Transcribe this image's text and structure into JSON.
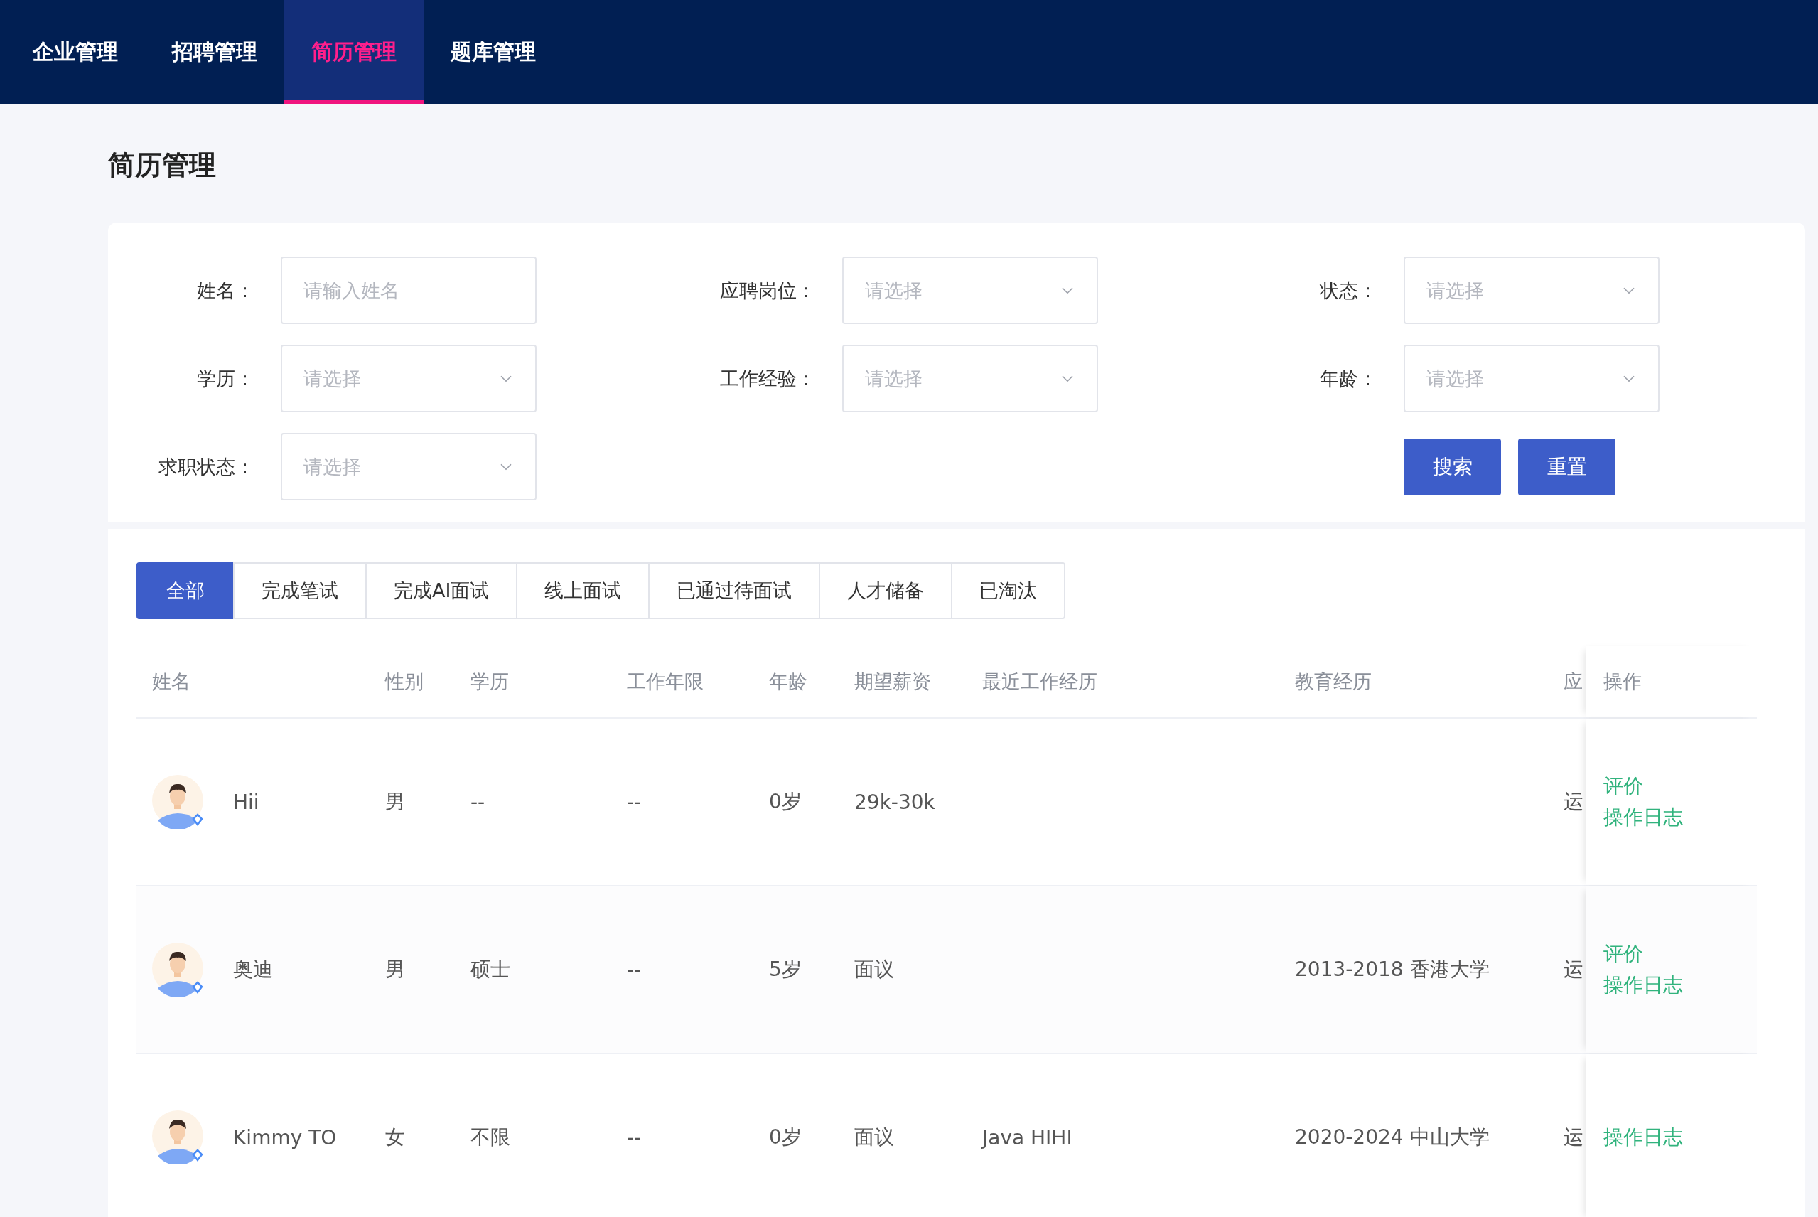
{
  "nav": [
    {
      "label": "企业管理",
      "selected": false
    },
    {
      "label": "招聘管理",
      "selected": false
    },
    {
      "label": "简历管理",
      "selected": true
    },
    {
      "label": "题库管理",
      "selected": false
    }
  ],
  "page_title": "简历管理",
  "filters": [
    {
      "label": "姓名：",
      "placeholder": "请输入姓名",
      "kind": "input"
    },
    {
      "label": "应聘岗位：",
      "placeholder": "请选择",
      "kind": "select"
    },
    {
      "label": "状态：",
      "placeholder": "请选择",
      "kind": "select"
    },
    {
      "label": "学历：",
      "placeholder": "请选择",
      "kind": "select"
    },
    {
      "label": "工作经验：",
      "placeholder": "请选择",
      "kind": "select"
    },
    {
      "label": "年龄：",
      "placeholder": "请选择",
      "kind": "select"
    },
    {
      "label": "求职状态：",
      "placeholder": "请选择",
      "kind": "select"
    }
  ],
  "buttons": [
    "搜索",
    "重置"
  ],
  "status_tabs": [
    {
      "label": "全部",
      "selected": true
    },
    {
      "label": "完成笔试",
      "selected": false
    },
    {
      "label": "完成AI面试",
      "selected": false
    },
    {
      "label": "线上面试",
      "selected": false
    },
    {
      "label": "已通过待面试",
      "selected": false
    },
    {
      "label": "人才储备",
      "selected": false
    },
    {
      "label": "已淘汰",
      "selected": false
    }
  ],
  "table": {
    "columns": [
      "姓名",
      "性别",
      "学历",
      "工作年限",
      "年龄",
      "期望薪资",
      "最近工作经历",
      "教育经历",
      "应",
      "操作"
    ],
    "rows": [
      {
        "name": "Hii",
        "gender": "男",
        "education": "--",
        "work_years": "--",
        "age": "0岁",
        "salary": "29k-30k",
        "recent_work": "",
        "education_history": "",
        "column_9": "运",
        "actions": [
          "评价",
          "操作日志"
        ]
      },
      {
        "name": "奥迪",
        "gender": "男",
        "education": "硕士",
        "work_years": "--",
        "age": "5岁",
        "salary": "面议",
        "recent_work": "",
        "education_history": "2013-2018 香港大学",
        "column_9": "运",
        "actions": [
          "评价",
          "操作日志"
        ]
      },
      {
        "name": "Kimmy TO",
        "gender": "女",
        "education": "不限",
        "work_years": "--",
        "age": "0岁",
        "salary": "面议",
        "recent_work": "Java HIHI",
        "education_history": "2020-2024 中山大学",
        "column_9": "运",
        "actions": [
          "操作日志"
        ]
      }
    ]
  }
}
